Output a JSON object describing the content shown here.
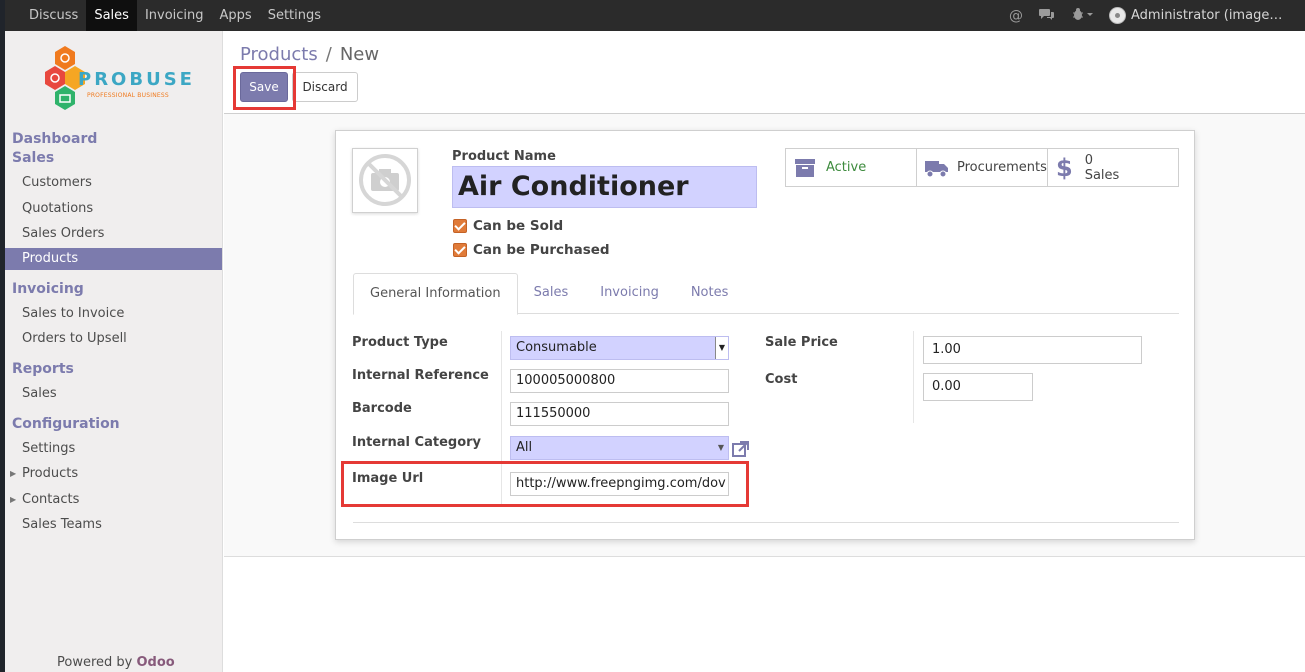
{
  "topnav": {
    "items": [
      "Discuss",
      "Sales",
      "Invoicing",
      "Apps",
      "Settings"
    ],
    "active": "Sales",
    "user": "Administrator (image…"
  },
  "sidebar": {
    "logo": {
      "brand": "PROBUSE",
      "tagline": "PROFESSIONAL BUSINESS"
    },
    "sections": [
      {
        "title": "Dashboard"
      },
      {
        "title": "Sales",
        "items": [
          "Customers",
          "Quotations",
          "Sales Orders",
          "Products"
        ]
      },
      {
        "title": "Invoicing",
        "items": [
          "Sales to Invoice",
          "Orders to Upsell"
        ]
      },
      {
        "title": "Reports",
        "items": [
          "Sales"
        ]
      },
      {
        "title": "Configuration",
        "items": [
          "Settings",
          "Products",
          "Contacts",
          "Sales Teams"
        ]
      }
    ],
    "active_item": "Products",
    "powered_prefix": "Powered by",
    "powered_brand": "Odoo"
  },
  "breadcrumb": {
    "parent": "Products",
    "sep": "/",
    "current": "New"
  },
  "buttons": {
    "save": "Save",
    "discard": "Discard"
  },
  "form": {
    "name_label": "Product Name",
    "name_value": "Air Conditioner",
    "can_be_sold": "Can be Sold",
    "can_be_purchased": "Can be Purchased",
    "smart_buttons": {
      "active": "Active",
      "procurements": "Procurements",
      "sales_count": "0",
      "sales_label": "Sales"
    },
    "tabs": [
      "General Information",
      "Sales",
      "Invoicing",
      "Notes"
    ],
    "active_tab": "General Information",
    "fields": {
      "product_type": {
        "label": "Product Type",
        "value": "Consumable"
      },
      "internal_reference": {
        "label": "Internal Reference",
        "value": "100005000800"
      },
      "barcode": {
        "label": "Barcode",
        "value": "111550000"
      },
      "internal_category": {
        "label": "Internal Category",
        "value": "All"
      },
      "image_url": {
        "label": "Image Url",
        "value": "http://www.freepngimg.com/dov"
      },
      "sale_price": {
        "label": "Sale Price",
        "value": "1.00"
      },
      "cost": {
        "label": "Cost",
        "value": "0.00"
      }
    }
  },
  "colors": {
    "accent": "#7c7bad",
    "highlight": "#e53935",
    "required_bg": "#d2d2ff",
    "active_green": "#3d8b3d"
  }
}
